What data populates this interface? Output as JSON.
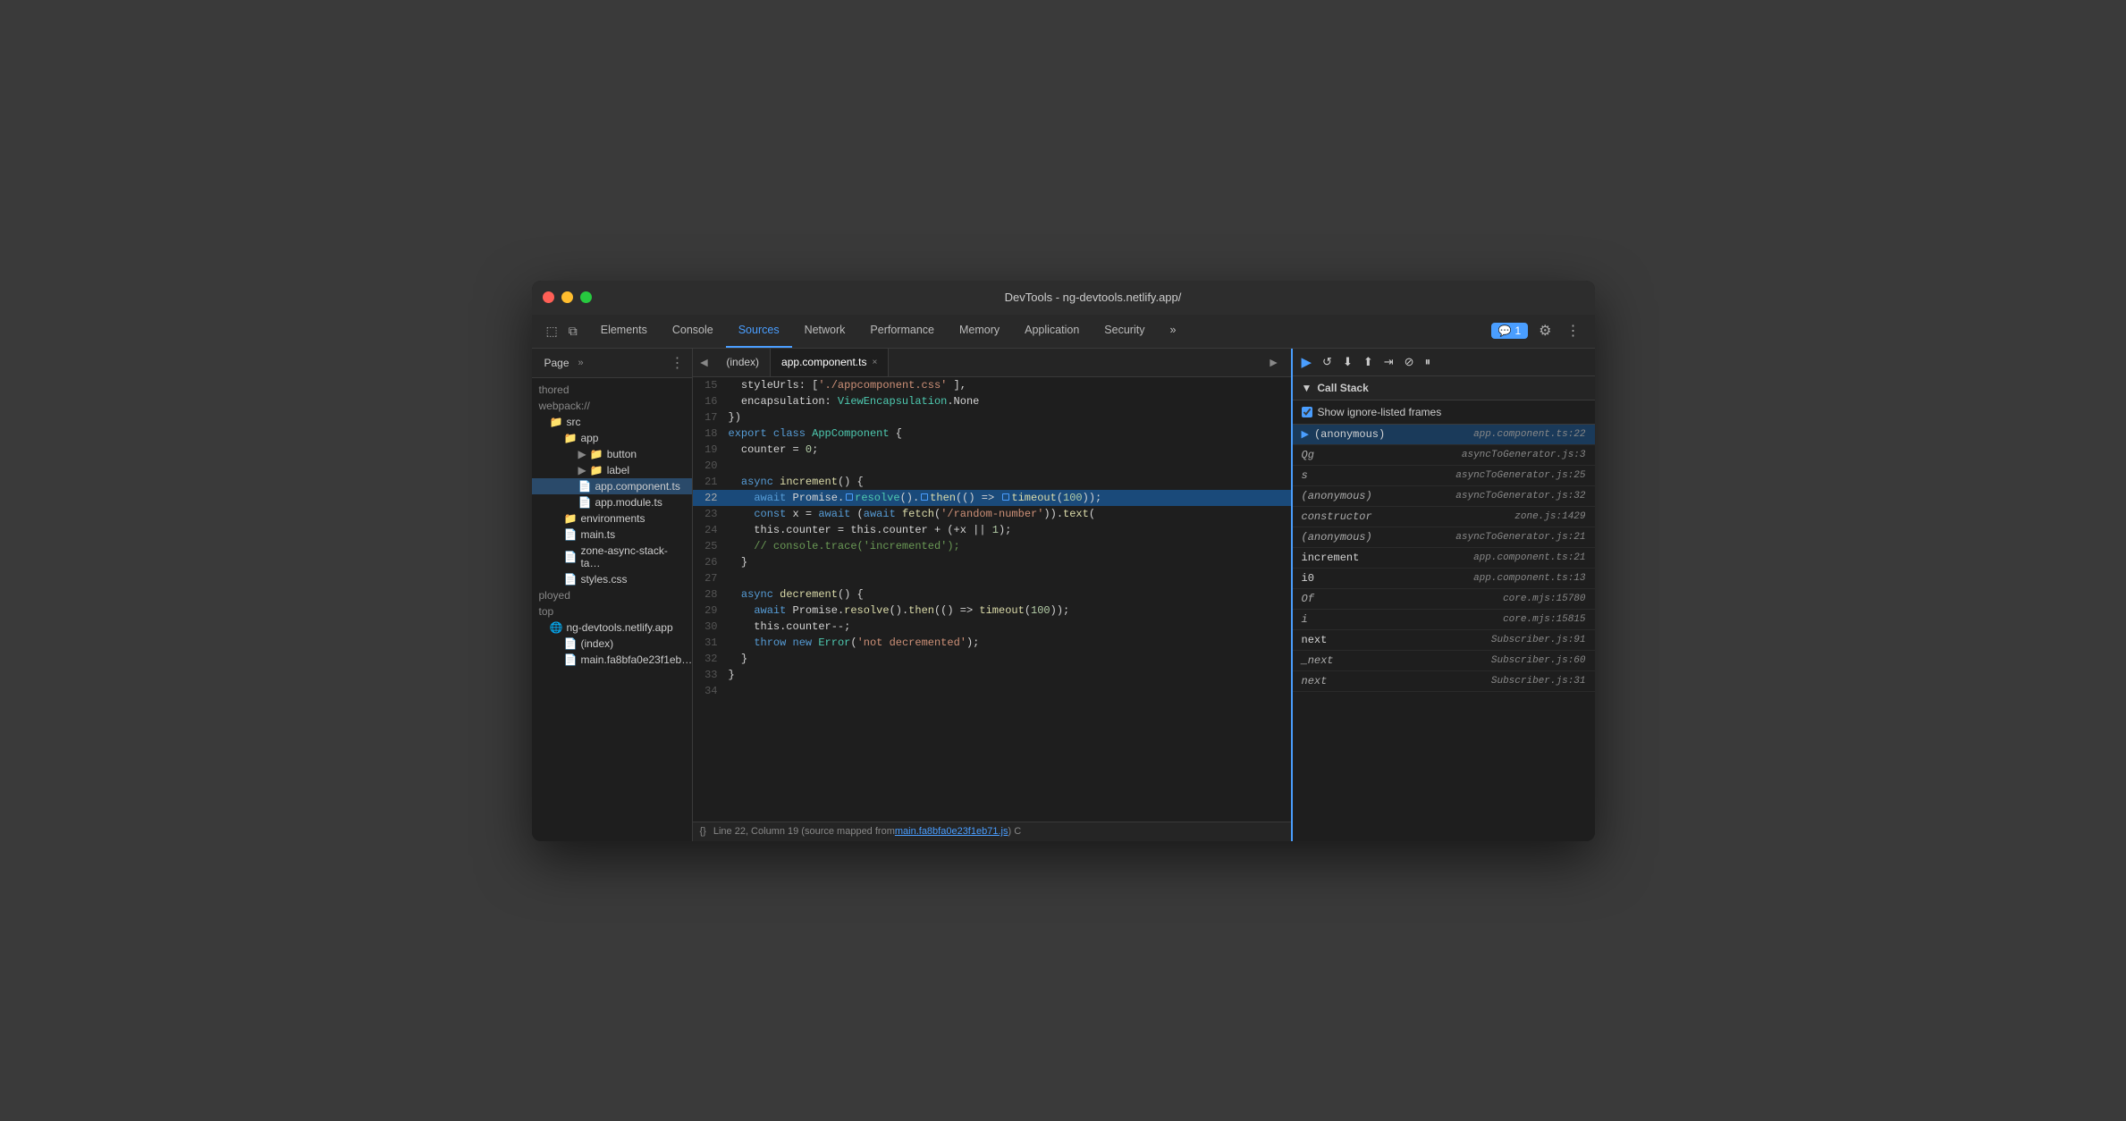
{
  "window": {
    "title": "DevTools - ng-devtools.netlify.app/"
  },
  "titlebar": {
    "title": "DevTools - ng-devtools.netlify.app/"
  },
  "tabs": {
    "items": [
      {
        "label": "Elements",
        "active": false
      },
      {
        "label": "Console",
        "active": false
      },
      {
        "label": "Sources",
        "active": true
      },
      {
        "label": "Network",
        "active": false
      },
      {
        "label": "Performance",
        "active": false
      },
      {
        "label": "Memory",
        "active": false
      },
      {
        "label": "Application",
        "active": false
      },
      {
        "label": "Security",
        "active": false
      }
    ],
    "more_label": "»",
    "badge_count": "1",
    "settings_icon": "⚙",
    "more_icon": "⋮"
  },
  "sidebar": {
    "tab_label": "Page",
    "more_label": "»",
    "menu_icon": "⋮",
    "tree": [
      {
        "label": "thored",
        "indent": 0,
        "type": "text"
      },
      {
        "label": "webpack://",
        "indent": 0,
        "type": "text"
      },
      {
        "label": "src",
        "indent": 1,
        "type": "folder-orange"
      },
      {
        "label": "app",
        "indent": 2,
        "type": "folder-orange"
      },
      {
        "label": "button",
        "indent": 3,
        "type": "folder-orange",
        "has_arrow": true
      },
      {
        "label": "label",
        "indent": 3,
        "type": "folder-orange",
        "has_arrow": true
      },
      {
        "label": "app.component.ts",
        "indent": 3,
        "type": "file-selected"
      },
      {
        "label": "app.module.ts",
        "indent": 3,
        "type": "file-plain"
      },
      {
        "label": "environments",
        "indent": 2,
        "type": "folder-orange"
      },
      {
        "label": "main.ts",
        "indent": 2,
        "type": "file-plain"
      },
      {
        "label": "zone-async-stack-ta…",
        "indent": 2,
        "type": "file-plain"
      },
      {
        "label": "styles.css",
        "indent": 2,
        "type": "file-purple"
      },
      {
        "label": "ployed",
        "indent": 0,
        "type": "text"
      },
      {
        "label": "top",
        "indent": 0,
        "type": "text"
      },
      {
        "label": "ng-devtools.netlify.app",
        "indent": 1,
        "type": "globe"
      },
      {
        "label": "(index)",
        "indent": 2,
        "type": "file-plain"
      },
      {
        "label": "main.fa8bfa0e23f1eb…",
        "indent": 2,
        "type": "file-plain"
      }
    ]
  },
  "code": {
    "nav_back": "◄",
    "tab_index": "(index)",
    "tab_file": "app.component.ts",
    "tab_close": "×",
    "expand_icon": "►",
    "lines": [
      {
        "num": 15,
        "content": "  styleUrls: ['./app.component.css' ],",
        "highlight": false
      },
      {
        "num": 16,
        "content": "  encapsulation: ViewEncapsulation.None",
        "highlight": false
      },
      {
        "num": 17,
        "content": "})",
        "highlight": false
      },
      {
        "num": 18,
        "content": "export class AppComponent {",
        "highlight": false
      },
      {
        "num": 19,
        "content": "  counter = 0;",
        "highlight": false
      },
      {
        "num": 20,
        "content": "",
        "highlight": false
      },
      {
        "num": 21,
        "content": "  async increment() {",
        "highlight": false
      },
      {
        "num": 22,
        "content": "    await Promise.resolve().then(() => timeout(100));",
        "highlight": true
      },
      {
        "num": 23,
        "content": "    const x = await (await fetch('/random-number')).text(",
        "highlight": false
      },
      {
        "num": 24,
        "content": "    this.counter = this.counter + (+x || 1);",
        "highlight": false
      },
      {
        "num": 25,
        "content": "    // console.trace('incremented');",
        "highlight": false
      },
      {
        "num": 26,
        "content": "  }",
        "highlight": false
      },
      {
        "num": 27,
        "content": "",
        "highlight": false
      },
      {
        "num": 28,
        "content": "  async decrement() {",
        "highlight": false
      },
      {
        "num": 29,
        "content": "    await Promise.resolve().then(() => timeout(100));",
        "highlight": false
      },
      {
        "num": 30,
        "content": "    this.counter--;",
        "highlight": false
      },
      {
        "num": 31,
        "content": "    throw new Error('not decremented');",
        "highlight": false
      },
      {
        "num": 32,
        "content": "  }",
        "highlight": false
      },
      {
        "num": 33,
        "content": "}",
        "highlight": false
      },
      {
        "num": 34,
        "content": "",
        "highlight": false
      }
    ]
  },
  "status_bar": {
    "brackets": "{}",
    "text": "Line 22, Column 19 (source mapped from ",
    "link": "main.fa8bfa0e23f1eb71.js",
    "text_after": ") C"
  },
  "debug_toolbar": {
    "buttons": [
      {
        "icon": "▶",
        "label": "resume",
        "active": true
      },
      {
        "icon": "↺",
        "label": "step-over"
      },
      {
        "icon": "↓",
        "label": "step-into"
      },
      {
        "icon": "↑",
        "label": "step-out"
      },
      {
        "icon": "⇥",
        "label": "step"
      },
      {
        "icon": "⊘",
        "label": "deactivate"
      },
      {
        "icon": "⏸",
        "label": "pause-on-exceptions"
      }
    ]
  },
  "call_stack": {
    "header": "Call Stack",
    "show_ignored_label": "Show ignore-listed frames",
    "items": [
      {
        "name": "(anonymous)",
        "location": "app.component.ts:22",
        "active": true,
        "italic": false,
        "arrow": true
      },
      {
        "name": "Qg",
        "location": "asyncToGenerator.js:3",
        "active": false,
        "italic": true
      },
      {
        "name": "s",
        "location": "asyncToGenerator.js:25",
        "active": false,
        "italic": true
      },
      {
        "name": "(anonymous)",
        "location": "asyncToGenerator.js:32",
        "active": false,
        "italic": true
      },
      {
        "name": "constructor",
        "location": "zone.js:1429",
        "active": false,
        "italic": true
      },
      {
        "name": "(anonymous)",
        "location": "asyncToGenerator.js:21",
        "active": false,
        "italic": true
      },
      {
        "name": "increment",
        "location": "app.component.ts:21",
        "active": false,
        "italic": false
      },
      {
        "name": "i0",
        "location": "app.component.ts:13",
        "active": false,
        "italic": false
      },
      {
        "name": "Of",
        "location": "core.mjs:15780",
        "active": false,
        "italic": true
      },
      {
        "name": "i",
        "location": "core.mjs:15815",
        "active": false,
        "italic": true
      },
      {
        "name": "next",
        "location": "Subscriber.js:91",
        "active": false,
        "italic": false
      },
      {
        "name": "_next",
        "location": "Subscriber.js:60",
        "active": false,
        "italic": true
      },
      {
        "name": "next",
        "location": "Subscriber.js:31",
        "active": false,
        "italic": true
      }
    ]
  }
}
